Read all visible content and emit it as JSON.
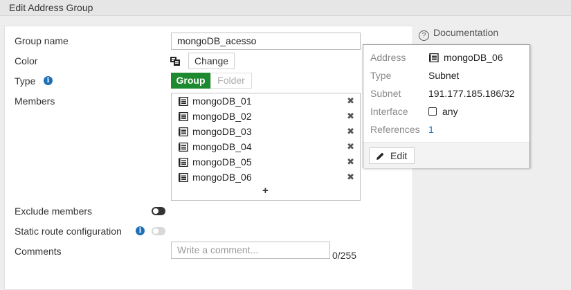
{
  "window": {
    "title": "Edit Address Group"
  },
  "form": {
    "group_name_label": "Group name",
    "group_name_value": "mongoDB_acesso",
    "color_label": "Color",
    "change_label": "Change",
    "type_label": "Type",
    "type_options": [
      "Group",
      "Folder"
    ],
    "type_selected": "Group",
    "members_label": "Members",
    "members": [
      "mongoDB_01",
      "mongoDB_02",
      "mongoDB_03",
      "mongoDB_04",
      "mongoDB_05",
      "mongoDB_06"
    ],
    "add_symbol": "+",
    "remove_symbol": "✖",
    "exclude_members_label": "Exclude members",
    "exclude_members_enabled": false,
    "static_route_label": "Static route configuration",
    "static_route_enabled": false,
    "comments_label": "Comments",
    "comments_placeholder": "Write a comment...",
    "comments_counter": "0/255"
  },
  "sidebar": {
    "documentation_label": "Documentation"
  },
  "tooltip": {
    "address_label": "Address",
    "address_value": "mongoDB_06",
    "type_label": "Type",
    "type_value": "Subnet",
    "subnet_label": "Subnet",
    "subnet_value": "191.177.185.186/32",
    "interface_label": "Interface",
    "interface_value": "any",
    "references_label": "References",
    "references_value": "1",
    "edit_label": "Edit"
  },
  "colors": {
    "group_active": "#1e8a2f",
    "info_icon": "#1e6fb5",
    "link": "#1e6fb5",
    "toggle_off": "#333333",
    "toggle_disabled": "#d8d8d8"
  }
}
